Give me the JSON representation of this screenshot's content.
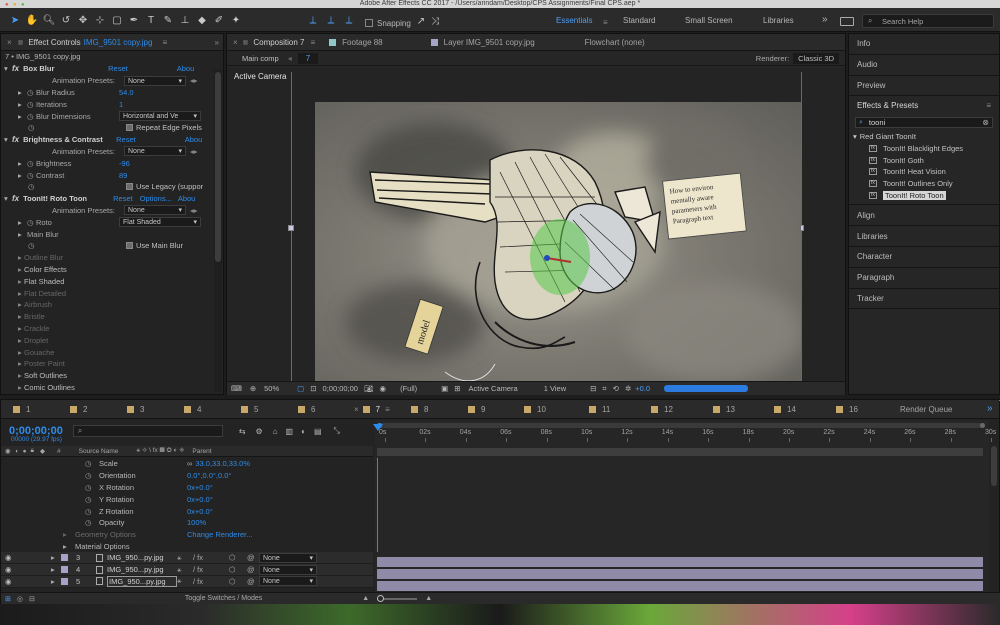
{
  "title": "Adobe After Effects CC 2017 - /Users/arindam/Desktop/CPS Assignments/Final CPS.aep *",
  "toolbar": {
    "snapping": "Snapping",
    "workspaces": [
      "Essentials",
      "Standard",
      "Small Screen",
      "Libraries"
    ],
    "search_placeholder": "Search Help"
  },
  "effect_controls": {
    "tab": "Effect Controls",
    "tab_file": "IMG_9501 copy.jpg",
    "layer_path": "7 • IMG_9501 copy.jpg",
    "effects": [
      {
        "name": "Box Blur",
        "reset": "Reset",
        "about": "Abou",
        "rows": [
          {
            "label": "Animation Presets:",
            "value": "None",
            "kind": "drop"
          },
          {
            "label": "Blur Radius",
            "value": "54.0",
            "kind": "num"
          },
          {
            "label": "Iterations",
            "value": "1",
            "kind": "num"
          },
          {
            "label": "Blur Dimensions",
            "value": "Horizontal and Ve",
            "kind": "drop"
          },
          {
            "label": "",
            "value": "Repeat Edge Pixels",
            "kind": "check"
          }
        ]
      },
      {
        "name": "Brightness & Contrast",
        "reset": "Reset",
        "about": "Abou",
        "rows": [
          {
            "label": "Animation Presets:",
            "value": "None",
            "kind": "drop"
          },
          {
            "label": "Brightness",
            "value": "-96",
            "kind": "num"
          },
          {
            "label": "Contrast",
            "value": "89",
            "kind": "num"
          },
          {
            "label": "",
            "value": "Use Legacy (suppor",
            "kind": "check"
          }
        ]
      },
      {
        "name": "ToonIt! Roto Toon",
        "reset": "Reset",
        "options": "Options...",
        "about": "Abou",
        "rows": [
          {
            "label": "Animation Presets:",
            "value": "None",
            "kind": "drop"
          },
          {
            "label": "Roto",
            "value": "Flat Shaded",
            "kind": "drop"
          },
          {
            "label": "Main Blur",
            "value": "",
            "kind": "group"
          },
          {
            "label": "",
            "value": "Use Main Blur",
            "kind": "check"
          }
        ]
      }
    ],
    "subgroups": [
      {
        "label": "Outline Blur",
        "dim": true
      },
      {
        "label": "Color Effects",
        "dim": false
      },
      {
        "label": "Flat Shaded",
        "dim": false
      },
      {
        "label": "Flat Detailed",
        "dim": true
      },
      {
        "label": "Airbrush",
        "dim": true
      },
      {
        "label": "Bristle",
        "dim": true
      },
      {
        "label": "Crackle",
        "dim": true
      },
      {
        "label": "Droplet",
        "dim": true
      },
      {
        "label": "Gouache",
        "dim": true
      },
      {
        "label": "Poster Paint",
        "dim": true
      },
      {
        "label": "Soft Outlines",
        "dim": false
      },
      {
        "label": "Comic Outlines",
        "dim": false
      }
    ]
  },
  "composition": {
    "tabs": [
      "Composition 7",
      "Footage 88",
      "Layer IMG_9501 copy.jpg",
      "Flowchart (none)"
    ],
    "breadcrumb": "Main comp",
    "comp_num": "7",
    "renderer_label": "Renderer:",
    "renderer": "Classic 3D",
    "active_camera": "Active Camera",
    "sketch_note": "How to environ mentally aware parameters with Paragraph text",
    "sketch_label": "model",
    "bottom": {
      "zoom": "50%",
      "time": "0;00;00;00",
      "resolution": "(Full)",
      "camera": "Active Camera",
      "view": "1 View",
      "exposure": "+0.0"
    }
  },
  "right_panel": {
    "top_items": [
      "Info",
      "Audio",
      "Preview"
    ],
    "effects_title": "Effects & Presets",
    "search_value": "tooni",
    "group": "Red Giant ToonIt",
    "effects": [
      "ToonIt! Blacklight Edges",
      "ToonIt! Goth",
      "ToonIt! Heat Vision",
      "ToonIt! Outlines Only",
      "ToonIt! Roto Toon"
    ],
    "bottom_items": [
      "Align",
      "Libraries",
      "Character",
      "Paragraph",
      "Tracker"
    ]
  },
  "timeline": {
    "tabs": [
      "1",
      "2",
      "3",
      "4",
      "5",
      "6",
      "7",
      "8",
      "9",
      "10",
      "11",
      "12",
      "13",
      "14",
      "16"
    ],
    "render_queue": "Render Queue",
    "timecode": "0;00;00;00",
    "fps": "00000 (29.97 fps)",
    "column_source": "Source Name",
    "column_parent": "Parent",
    "ruler": [
      "0s",
      "02s",
      "04s",
      "06s",
      "08s",
      "10s",
      "12s",
      "14s",
      "16s",
      "18s",
      "20s",
      "22s",
      "24s",
      "26s",
      "28s",
      "30s"
    ],
    "props": [
      {
        "label": "Scale",
        "value": "33.0,33.0,33.0%"
      },
      {
        "label": "Orientation",
        "value": "0.0°,0.0°,0.0°"
      },
      {
        "label": "X Rotation",
        "value": "0x+0.0°"
      },
      {
        "label": "Y Rotation",
        "value": "0x+0.0°"
      },
      {
        "label": "Z Rotation",
        "value": "0x+0.0°"
      },
      {
        "label": "Opacity",
        "value": "100%"
      }
    ],
    "geometry": "Geometry Options",
    "change_renderer": "Change Renderer...",
    "material": "Material Options",
    "layers": [
      {
        "num": "3",
        "name": "IMG_950...py.jpg",
        "parent": "None"
      },
      {
        "num": "4",
        "name": "IMG_950...py.jpg",
        "parent": "None"
      },
      {
        "num": "5",
        "name": "IMG_950...py.jpg",
        "parent": "None"
      }
    ],
    "toggle": "Toggle Switches / Modes"
  }
}
